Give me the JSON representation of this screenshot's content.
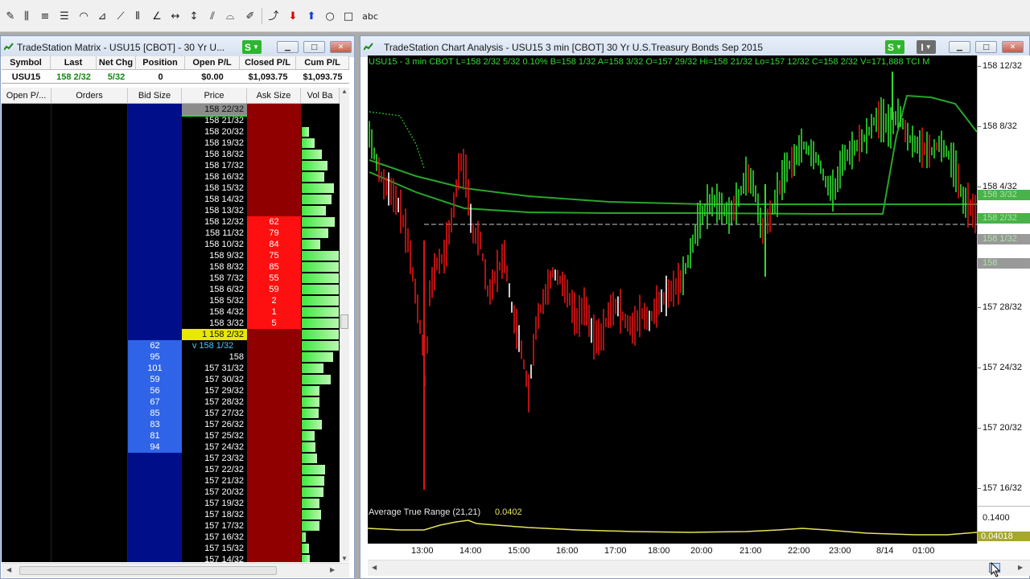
{
  "toolbar": {
    "tools": [
      {
        "name": "pencil-tool-icon",
        "glyph": "✎"
      },
      {
        "name": "vertical-lines-tool-icon",
        "glyph": "⫼"
      },
      {
        "name": "horizontal-lines-tool-icon",
        "glyph": "≡"
      },
      {
        "name": "fib-retracement-tool-icon",
        "glyph": "☰"
      },
      {
        "name": "fib-arc-tool-icon",
        "glyph": "◠"
      },
      {
        "name": "fan-lines-tool-icon",
        "glyph": "⊿"
      },
      {
        "name": "speed-lines-tool-icon",
        "glyph": "⟋"
      },
      {
        "name": "gann-lines-tool-icon",
        "glyph": "⦀"
      },
      {
        "name": "trend-angle-tool-icon",
        "glyph": "∠"
      },
      {
        "name": "horizontal-arrow-tool-icon",
        "glyph": "↔"
      },
      {
        "name": "vertical-arrow-tool-icon",
        "glyph": "↕"
      },
      {
        "name": "parallel-lines-tool-icon",
        "glyph": "⫽"
      },
      {
        "name": "andrews-pitchfork-tool-icon",
        "glyph": "⌓"
      },
      {
        "name": "freehand-tool-icon",
        "glyph": "✐"
      },
      {
        "name": "curve-tool-icon",
        "glyph": "⤴"
      },
      {
        "name": "down-arrow-tool-icon",
        "glyph": "⬇"
      },
      {
        "name": "up-arrow-tool-icon",
        "glyph": "⬆"
      },
      {
        "name": "ellipse-tool-icon",
        "glyph": "○"
      },
      {
        "name": "rectangle-tool-icon",
        "glyph": "□"
      },
      {
        "name": "text-tool-icon",
        "glyph": "abc"
      }
    ]
  },
  "matrix": {
    "title": "TradeStation Matrix - USU15 [CBOT] - 30 Yr U...",
    "s_label": "S",
    "summary_headers": [
      "Symbol",
      "Last",
      "Net Chg",
      "Position",
      "Open P/L",
      "Closed P/L",
      "Cum P/L"
    ],
    "summary_values": [
      "USU15",
      "158 2/32",
      "5/32",
      "0",
      "$0.00",
      "$1,093.75",
      "$1,093.75"
    ],
    "summary_colors": [
      "#111111",
      "#108a10",
      "#108a10",
      "#111111",
      "#111111",
      "#111111",
      "#111111"
    ],
    "ladder_headers": [
      "Open P/...",
      "Orders",
      "Bid Size",
      "Price",
      "Ask Size",
      "Vol Ba"
    ],
    "rows": [
      {
        "price": "158 22/32",
        "bid": "",
        "ask": "",
        "vol": 0,
        "type": "top"
      },
      {
        "price": "158 21/32",
        "bid": "",
        "ask": "",
        "vol": 0
      },
      {
        "price": "158 20/32",
        "bid": "",
        "ask": "",
        "vol": 20
      },
      {
        "price": "158 19/32",
        "bid": "",
        "ask": "",
        "vol": 35
      },
      {
        "price": "158 18/32",
        "bid": "",
        "ask": "",
        "vol": 55
      },
      {
        "price": "158 17/32",
        "bid": "",
        "ask": "",
        "vol": 70
      },
      {
        "price": "158 16/32",
        "bid": "",
        "ask": "",
        "vol": 60
      },
      {
        "price": "158 15/32",
        "bid": "",
        "ask": "",
        "vol": 88
      },
      {
        "price": "158 14/32",
        "bid": "",
        "ask": "",
        "vol": 80
      },
      {
        "price": "158 13/32",
        "bid": "",
        "ask": "",
        "vol": 65
      },
      {
        "price": "158 12/32",
        "bid": "",
        "ask": "62",
        "vol": 90
      },
      {
        "price": "158 11/32",
        "bid": "",
        "ask": "79",
        "vol": 72
      },
      {
        "price": "158 10/32",
        "bid": "",
        "ask": "84",
        "vol": 50
      },
      {
        "price": "158 9/32",
        "bid": "",
        "ask": "75",
        "vol": 100
      },
      {
        "price": "158 8/32",
        "bid": "",
        "ask": "85",
        "vol": 100
      },
      {
        "price": "158 7/32",
        "bid": "",
        "ask": "55",
        "vol": 100
      },
      {
        "price": "158 6/32",
        "bid": "",
        "ask": "59",
        "vol": 100
      },
      {
        "price": "158 5/32",
        "bid": "",
        "ask": "2",
        "vol": 100
      },
      {
        "price": "158 4/32",
        "bid": "",
        "ask": "1",
        "vol": 100
      },
      {
        "price": "158 3/32",
        "bid": "",
        "ask": "5",
        "vol": 100
      },
      {
        "price": "1   158 2/32",
        "bid": "",
        "ask": "",
        "vol": 100,
        "type": "last"
      },
      {
        "price": "v 158 1/32",
        "bid": "62",
        "ask": "",
        "vol": 100,
        "type": "bidtop"
      },
      {
        "price": "158",
        "bid": "95",
        "ask": "",
        "vol": 85
      },
      {
        "price": "157 31/32",
        "bid": "101",
        "ask": "",
        "vol": 58
      },
      {
        "price": "157 30/32",
        "bid": "59",
        "ask": "",
        "vol": 78
      },
      {
        "price": "157 29/32",
        "bid": "56",
        "ask": "",
        "vol": 48
      },
      {
        "price": "157 28/32",
        "bid": "67",
        "ask": "",
        "vol": 48
      },
      {
        "price": "157 27/32",
        "bid": "85",
        "ask": "",
        "vol": 45
      },
      {
        "price": "157 26/32",
        "bid": "83",
        "ask": "",
        "vol": 55
      },
      {
        "price": "157 25/32",
        "bid": "81",
        "ask": "",
        "vol": 35
      },
      {
        "price": "157 24/32",
        "bid": "94",
        "ask": "",
        "vol": 38
      },
      {
        "price": "157 23/32",
        "bid": "",
        "ask": "",
        "vol": 42
      },
      {
        "price": "157 22/32",
        "bid": "",
        "ask": "",
        "vol": 62
      },
      {
        "price": "157 21/32",
        "bid": "",
        "ask": "",
        "vol": 60
      },
      {
        "price": "157 20/32",
        "bid": "",
        "ask": "",
        "vol": 58
      },
      {
        "price": "157 19/32",
        "bid": "",
        "ask": "",
        "vol": 48
      },
      {
        "price": "157 18/32",
        "bid": "",
        "ask": "",
        "vol": 52
      },
      {
        "price": "157 17/32",
        "bid": "",
        "ask": "",
        "vol": 48
      },
      {
        "price": "157 16/32",
        "bid": "",
        "ask": "",
        "vol": 10
      },
      {
        "price": "157 15/32",
        "bid": "",
        "ask": "",
        "vol": 20
      },
      {
        "price": "157 14/32",
        "bid": "",
        "ask": "",
        "vol": 22
      }
    ]
  },
  "chart": {
    "title": "TradeStation Chart Analysis - USU15 3 min [CBOT] 30 Yr U.S.Treasury Bonds Sep 2015",
    "s_label": "S",
    "i_label": "I",
    "status_line": "USU15 - 3 min  CBOT  L=158 2/32   5/32   0.10%   B=158 1/32   A=158 3/32   O=157 29/32  Hi=158 21/32  Lo=157 12/32  C=158 2/32  V=171,888  TCI M",
    "price_axis_labels": [
      "158 12/32",
      "158 8/32",
      "158 4/32",
      "157 28/32",
      "157 24/32",
      "157 20/32",
      "157 16/32"
    ],
    "price_axis_tags": [
      "158 3/32",
      "158 2/32",
      "158 1/32",
      "158"
    ],
    "indicator_label": "Average True Range (21,21)",
    "indicator_value": "0.0402",
    "indicator_axis_label": "0.1400",
    "indicator_axis_tag": "0.04018",
    "time_labels": [
      "13:00",
      "14:00",
      "15:00",
      "16:00",
      "17:00",
      "18:00",
      "20:00",
      "21:00",
      "22:00",
      "23:00",
      "8/14",
      "01:00"
    ]
  },
  "colors": {
    "up": "#2fdc2f",
    "down": "#e01515",
    "ma": "#2aa52a",
    "atr": "#e4e45a",
    "bid": "#000e8a",
    "bid_active": "#2f64e8",
    "ask": "#900000",
    "ask_active": "#ff1010",
    "last": "#e8e800"
  }
}
